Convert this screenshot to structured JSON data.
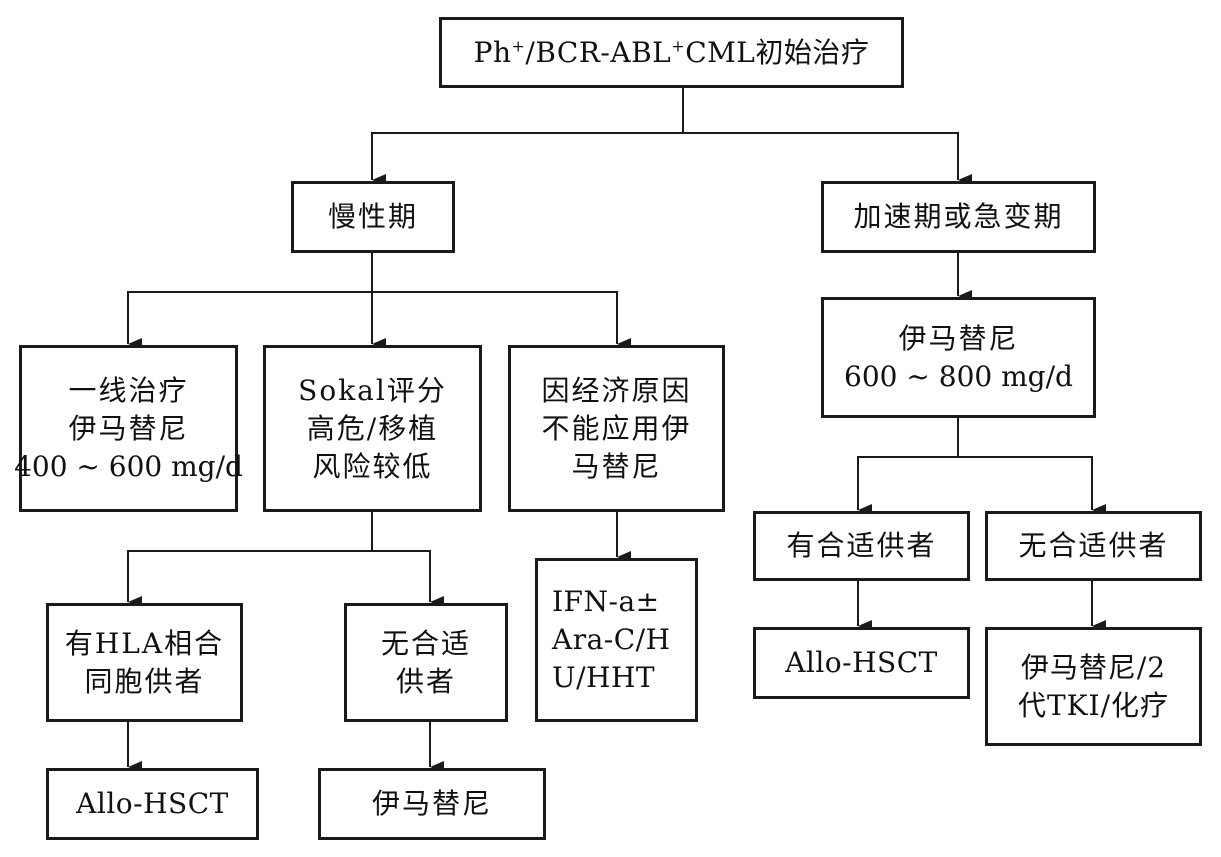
{
  "nodes": {
    "root": {
      "pre": "Ph",
      "sup1": "+",
      "mid": "/BCR-ABL",
      "sup2": "+",
      "post": "CML初始治疗"
    },
    "chronic": {
      "lines": [
        "慢性期"
      ]
    },
    "accel": {
      "lines": [
        "加速期或急变期"
      ]
    },
    "firstline": {
      "lines": [
        "一线治疗",
        "伊马替尼",
        "400 ~ 600 mg/d"
      ]
    },
    "sokal": {
      "lines": [
        "Sokal评分",
        "高危/移植",
        "风险较低"
      ]
    },
    "economic": {
      "lines": [
        "因经济原因",
        "不能应用伊",
        "马替尼"
      ]
    },
    "imatinib_high": {
      "lines": [
        "伊马替尼",
        "600 ~ 800 mg/d"
      ]
    },
    "hla_donor": {
      "lines": [
        "有HLA相合",
        "同胞供者"
      ]
    },
    "no_donor_left": {
      "lines": [
        "无合适",
        "供者"
      ]
    },
    "ifn": {
      "lines": [
        "IFN-a±",
        "Ara-C/H",
        "U/HHT"
      ]
    },
    "donor_right": {
      "lines": [
        "有合适供者"
      ]
    },
    "no_donor_right": {
      "lines": [
        "无合适供者"
      ]
    },
    "allo_left": {
      "lines": [
        "Allo-HSCT"
      ]
    },
    "imatinib_left": {
      "lines": [
        "伊马替尼"
      ]
    },
    "allo_right": {
      "lines": [
        "Allo-HSCT"
      ]
    },
    "tki_right": {
      "lines": [
        "伊马替尼/2",
        "代TKI/化疗"
      ]
    }
  }
}
